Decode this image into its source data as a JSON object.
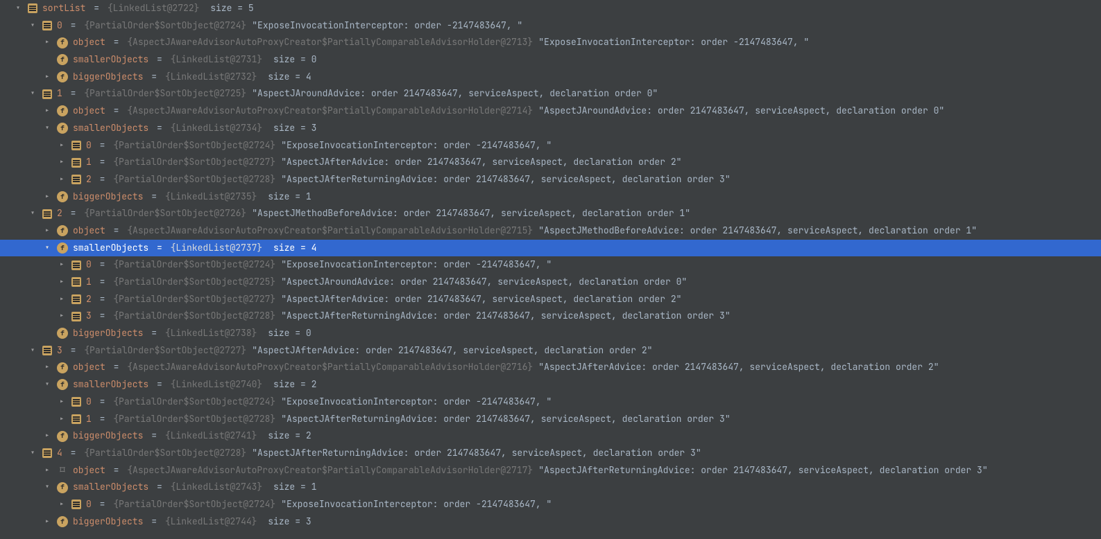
{
  "rows": [
    {
      "depth": 0,
      "arrow": "open",
      "icon": "list",
      "name": "sortList",
      "type": "{LinkedList@2722}",
      "val": " size = 5",
      "sel": false,
      "inter": true
    },
    {
      "depth": 1,
      "arrow": "open",
      "icon": "list",
      "name": "0",
      "type": "{PartialOrder$SortObject@2724}",
      "val": "\"ExposeInvocationInterceptor: order -2147483647, \"",
      "sel": false,
      "inter": true
    },
    {
      "depth": 2,
      "arrow": "closed",
      "icon": "f",
      "name": "object",
      "type": "{AspectJAwareAdvisorAutoProxyCreator$PartiallyComparableAdvisorHolder@2713}",
      "val": "\"ExposeInvocationInterceptor: order -2147483647, \"",
      "sel": false,
      "inter": true
    },
    {
      "depth": 2,
      "arrow": "none",
      "icon": "f",
      "name": "smallerObjects",
      "type": "{LinkedList@2731}",
      "val": " size = 0",
      "sel": false,
      "inter": true
    },
    {
      "depth": 2,
      "arrow": "closed",
      "icon": "f",
      "name": "biggerObjects",
      "type": "{LinkedList@2732}",
      "val": " size = 4",
      "sel": false,
      "inter": true
    },
    {
      "depth": 1,
      "arrow": "open",
      "icon": "list",
      "name": "1",
      "type": "{PartialOrder$SortObject@2725}",
      "val": "\"AspectJAroundAdvice: order 2147483647, serviceAspect, declaration order 0\"",
      "sel": false,
      "inter": true
    },
    {
      "depth": 2,
      "arrow": "closed",
      "icon": "f",
      "name": "object",
      "type": "{AspectJAwareAdvisorAutoProxyCreator$PartiallyComparableAdvisorHolder@2714}",
      "val": "\"AspectJAroundAdvice: order 2147483647, serviceAspect, declaration order 0\"",
      "sel": false,
      "inter": true
    },
    {
      "depth": 2,
      "arrow": "open",
      "icon": "f",
      "name": "smallerObjects",
      "type": "{LinkedList@2734}",
      "val": " size = 3",
      "sel": false,
      "inter": true
    },
    {
      "depth": 3,
      "arrow": "closed",
      "icon": "list",
      "name": "0",
      "type": "{PartialOrder$SortObject@2724}",
      "val": "\"ExposeInvocationInterceptor: order -2147483647, \"",
      "sel": false,
      "inter": true
    },
    {
      "depth": 3,
      "arrow": "closed",
      "icon": "list",
      "name": "1",
      "type": "{PartialOrder$SortObject@2727}",
      "val": "\"AspectJAfterAdvice: order 2147483647, serviceAspect, declaration order 2\"",
      "sel": false,
      "inter": true
    },
    {
      "depth": 3,
      "arrow": "closed",
      "icon": "list",
      "name": "2",
      "type": "{PartialOrder$SortObject@2728}",
      "val": "\"AspectJAfterReturningAdvice: order 2147483647, serviceAspect, declaration order 3\"",
      "sel": false,
      "inter": true
    },
    {
      "depth": 2,
      "arrow": "closed",
      "icon": "f",
      "name": "biggerObjects",
      "type": "{LinkedList@2735}",
      "val": " size = 1",
      "sel": false,
      "inter": true
    },
    {
      "depth": 1,
      "arrow": "open",
      "icon": "list",
      "name": "2",
      "type": "{PartialOrder$SortObject@2726}",
      "val": "\"AspectJMethodBeforeAdvice: order 2147483647, serviceAspect, declaration order 1\"",
      "sel": false,
      "inter": true
    },
    {
      "depth": 2,
      "arrow": "closed",
      "icon": "f",
      "name": "object",
      "type": "{AspectJAwareAdvisorAutoProxyCreator$PartiallyComparableAdvisorHolder@2715}",
      "val": "\"AspectJMethodBeforeAdvice: order 2147483647, serviceAspect, declaration order 1\"",
      "sel": false,
      "inter": true
    },
    {
      "depth": 2,
      "arrow": "open",
      "icon": "f",
      "name": "smallerObjects",
      "type": "{LinkedList@2737}",
      "val": " size = 4",
      "sel": true,
      "inter": true
    },
    {
      "depth": 3,
      "arrow": "closed",
      "icon": "list",
      "name": "0",
      "type": "{PartialOrder$SortObject@2724}",
      "val": "\"ExposeInvocationInterceptor: order -2147483647, \"",
      "sel": false,
      "inter": true
    },
    {
      "depth": 3,
      "arrow": "closed",
      "icon": "list",
      "name": "1",
      "type": "{PartialOrder$SortObject@2725}",
      "val": "\"AspectJAroundAdvice: order 2147483647, serviceAspect, declaration order 0\"",
      "sel": false,
      "inter": true
    },
    {
      "depth": 3,
      "arrow": "closed",
      "icon": "list",
      "name": "2",
      "type": "{PartialOrder$SortObject@2727}",
      "val": "\"AspectJAfterAdvice: order 2147483647, serviceAspect, declaration order 2\"",
      "sel": false,
      "inter": true
    },
    {
      "depth": 3,
      "arrow": "closed",
      "icon": "list",
      "name": "3",
      "type": "{PartialOrder$SortObject@2728}",
      "val": "\"AspectJAfterReturningAdvice: order 2147483647, serviceAspect, declaration order 3\"",
      "sel": false,
      "inter": true
    },
    {
      "depth": 2,
      "arrow": "none",
      "icon": "f",
      "name": "biggerObjects",
      "type": "{LinkedList@2738}",
      "val": " size = 0",
      "sel": false,
      "inter": true
    },
    {
      "depth": 1,
      "arrow": "open",
      "icon": "list",
      "name": "3",
      "type": "{PartialOrder$SortObject@2727}",
      "val": "\"AspectJAfterAdvice: order 2147483647, serviceAspect, declaration order 2\"",
      "sel": false,
      "inter": true
    },
    {
      "depth": 2,
      "arrow": "closed",
      "icon": "f",
      "name": "object",
      "type": "{AspectJAwareAdvisorAutoProxyCreator$PartiallyComparableAdvisorHolder@2716}",
      "val": "\"AspectJAfterAdvice: order 2147483647, serviceAspect, declaration order 2\"",
      "sel": false,
      "inter": true
    },
    {
      "depth": 2,
      "arrow": "open",
      "icon": "f",
      "name": "smallerObjects",
      "type": "{LinkedList@2740}",
      "val": " size = 2",
      "sel": false,
      "inter": true
    },
    {
      "depth": 3,
      "arrow": "closed",
      "icon": "list",
      "name": "0",
      "type": "{PartialOrder$SortObject@2724}",
      "val": "\"ExposeInvocationInterceptor: order -2147483647, \"",
      "sel": false,
      "inter": true
    },
    {
      "depth": 3,
      "arrow": "closed",
      "icon": "list",
      "name": "1",
      "type": "{PartialOrder$SortObject@2728}",
      "val": "\"AspectJAfterReturningAdvice: order 2147483647, serviceAspect, declaration order 3\"",
      "sel": false,
      "inter": true
    },
    {
      "depth": 2,
      "arrow": "closed",
      "icon": "f",
      "name": "biggerObjects",
      "type": "{LinkedList@2741}",
      "val": " size = 2",
      "sel": false,
      "inter": true
    },
    {
      "depth": 1,
      "arrow": "open",
      "icon": "list",
      "name": "4",
      "type": "{PartialOrder$SortObject@2728}",
      "val": "\"AspectJAfterReturningAdvice: order 2147483647, serviceAspect, declaration order 3\"",
      "sel": false,
      "inter": true
    },
    {
      "depth": 2,
      "arrow": "closed",
      "icon": "nav",
      "name": "object",
      "type": "{AspectJAwareAdvisorAutoProxyCreator$PartiallyComparableAdvisorHolder@2717}",
      "val": "\"AspectJAfterReturningAdvice: order 2147483647, serviceAspect, declaration order 3\"",
      "sel": false,
      "inter": true
    },
    {
      "depth": 2,
      "arrow": "open",
      "icon": "f",
      "name": "smallerObjects",
      "type": "{LinkedList@2743}",
      "val": " size = 1",
      "sel": false,
      "inter": true
    },
    {
      "depth": 3,
      "arrow": "closed",
      "icon": "list",
      "name": "0",
      "type": "{PartialOrder$SortObject@2724}",
      "val": "\"ExposeInvocationInterceptor: order -2147483647, \"",
      "sel": false,
      "inter": true
    },
    {
      "depth": 2,
      "arrow": "closed",
      "icon": "f",
      "name": "biggerObjects",
      "type": "{LinkedList@2744}",
      "val": " size = 3",
      "sel": false,
      "inter": true
    }
  ],
  "eq": "="
}
